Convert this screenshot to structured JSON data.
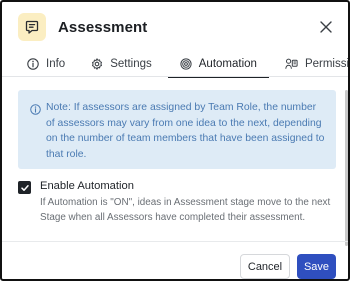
{
  "dialog": {
    "title": "Assessment",
    "icon": "assessment-icon",
    "accent": "#fbeec2"
  },
  "tabs": [
    {
      "label": "Info",
      "icon": "info-icon",
      "active": false
    },
    {
      "label": "Settings",
      "icon": "gear-icon",
      "active": false
    },
    {
      "label": "Automation",
      "icon": "automation-icon",
      "active": true
    },
    {
      "label": "Permissions",
      "icon": "permissions-icon",
      "active": false
    }
  ],
  "note": {
    "text": "Note: If assessors are assigned by Team Role, the number of assessors may vary from one idea to the next, depending on the number of team members that have been assigned to that role.",
    "background": "#deebf6",
    "color": "#4a7ab2"
  },
  "automation": {
    "checkbox_label": "Enable Automation",
    "checked": true,
    "description": "If Automation is \"ON\", ideas in Assessment stage move to the next Stage when all Assessors have completed their assessment."
  },
  "footer": {
    "cancel_label": "Cancel",
    "save_label": "Save",
    "save_color": "#2f4fbf"
  }
}
